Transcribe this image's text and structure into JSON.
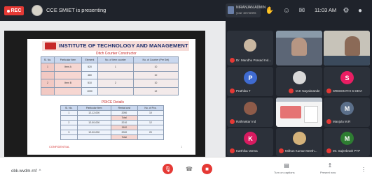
{
  "topbar": {
    "rec_label": "REC",
    "presenting_text": "CCE SMIET is presenting",
    "pill_line1": "NIRANJAN ADMIN",
    "pill_line2": "your 10 meets",
    "time": "11:03 AM"
  },
  "slide": {
    "title": "INSTITUTE OF TECHNOLOGY AND MANAGEMENT",
    "subtitle1": "Ditch Counter Constructor",
    "table1": {
      "headers": [
        "Sl. No.",
        "Particular Item",
        "Element",
        "No. of Item counter",
        "No. of Counter (Per Set)"
      ],
      "rows": [
        [
          "1",
          "Item A",
          "520",
          "1",
          "10"
        ],
        [
          "",
          "",
          "480",
          "",
          "10"
        ],
        [
          "2",
          "Item B",
          "510",
          "2",
          "10"
        ],
        [
          "",
          "",
          "1090",
          "",
          "12"
        ]
      ]
    },
    "subtitle2": "PRICE Details",
    "table2": {
      "headers": [
        "Sl. No.",
        "Particular Item",
        "Rental cost",
        "No. of Pcs."
      ],
      "rows": [
        [
          "1",
          "12-12-000",
          "2050",
          "10"
        ],
        [
          "",
          "",
          "Total",
          ""
        ],
        [
          "2",
          "12-00-000",
          "2010",
          "12"
        ],
        [
          "",
          "",
          "1500",
          ""
        ],
        [
          "3",
          "12-00-000",
          "2000",
          "20"
        ],
        [
          "",
          "",
          "Total",
          ""
        ]
      ]
    },
    "footer_left": "CONFIDENTIAL",
    "footer_right": "1"
  },
  "participants": [
    {
      "name": "Dr. Mandhu Prasad Ind...",
      "initial": "",
      "color": "#c9b7a1"
    },
    {
      "name": "Prathiba T",
      "initial": "P",
      "color": "#3f6bd1"
    },
    {
      "name": "M.K Nayaknande",
      "initial": "",
      "color": "#d9d9d9"
    },
    {
      "name": "SREEMATHI S DEVI",
      "initial": "S",
      "color": "#e91e63"
    },
    {
      "name": "Rathnakar Ind",
      "initial": "",
      "color": "#8e5b49"
    },
    {
      "name": "Manjula M.R",
      "initial": "M",
      "color": "#5b6f8a"
    },
    {
      "name": "Karthika Varma",
      "initial": "K",
      "color": "#d81b60"
    },
    {
      "name": "Mithun Kumar Meeth...",
      "initial": "",
      "color": "#d4b27a"
    },
    {
      "name": "Mr. Sajeebrath PTP",
      "initial": "M",
      "color": "#2e7d32"
    }
  ],
  "bottombar": {
    "meeting_code": "obk-wvdm-rnf",
    "turn_on_captions": "Turn on captions",
    "present_now": "Present now"
  },
  "icons": {
    "hand": "✋",
    "people": "☺",
    "chat": "✉",
    "activities": "⚙",
    "user": "●",
    "mic_off": "🎙",
    "end_call": "☎",
    "camera_off": "■",
    "more": "⋮",
    "captions": "▤",
    "present": "↥"
  },
  "colors": {
    "accent_red": "#e53935",
    "topbar": "#1f232b",
    "tile_dark": "#2c313a"
  }
}
